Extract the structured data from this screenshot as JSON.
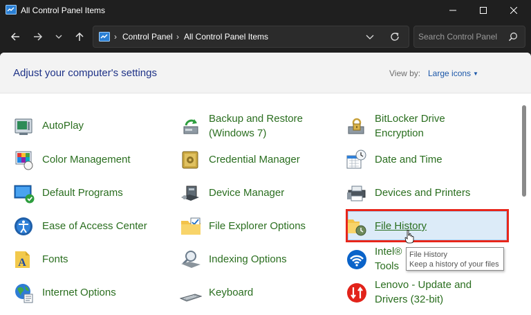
{
  "window": {
    "title": "All Control Panel Items"
  },
  "address": {
    "crumbs": [
      "Control Panel",
      "All Control Panel Items"
    ]
  },
  "search": {
    "placeholder": "Search Control Panel"
  },
  "header": {
    "heading": "Adjust your computer's settings",
    "view_by_label": "View by:",
    "view_by_value": "Large icons"
  },
  "items": {
    "autoplay": "AutoPlay",
    "backup_l1": "Backup and Restore",
    "backup_l2": "(Windows 7)",
    "bitlocker_l1": "BitLocker Drive",
    "bitlocker_l2": "Encryption",
    "color_management": "Color Management",
    "credential_manager": "Credential Manager",
    "date_time": "Date and Time",
    "default_programs": "Default Programs",
    "device_manager": "Device Manager",
    "devices_printers": "Devices and Printers",
    "ease_of_access": "Ease of Access Center",
    "file_explorer_options": "File Explorer Options",
    "file_history": "File History",
    "fonts": "Fonts",
    "indexing_options": "Indexing Options",
    "intel_l1": "Intel®",
    "intel_l2": "Tools",
    "internet_options": "Internet Options",
    "keyboard": "Keyboard",
    "lenovo_l1": "Lenovo - Update and",
    "lenovo_l2": "Drivers (32-bit)"
  },
  "tooltip": {
    "title": "File History",
    "description": "Keep a history of your files"
  },
  "colors": {
    "link_green": "#2a6e1f",
    "heading_blue": "#1e3287",
    "highlight_red": "#e8261a"
  }
}
